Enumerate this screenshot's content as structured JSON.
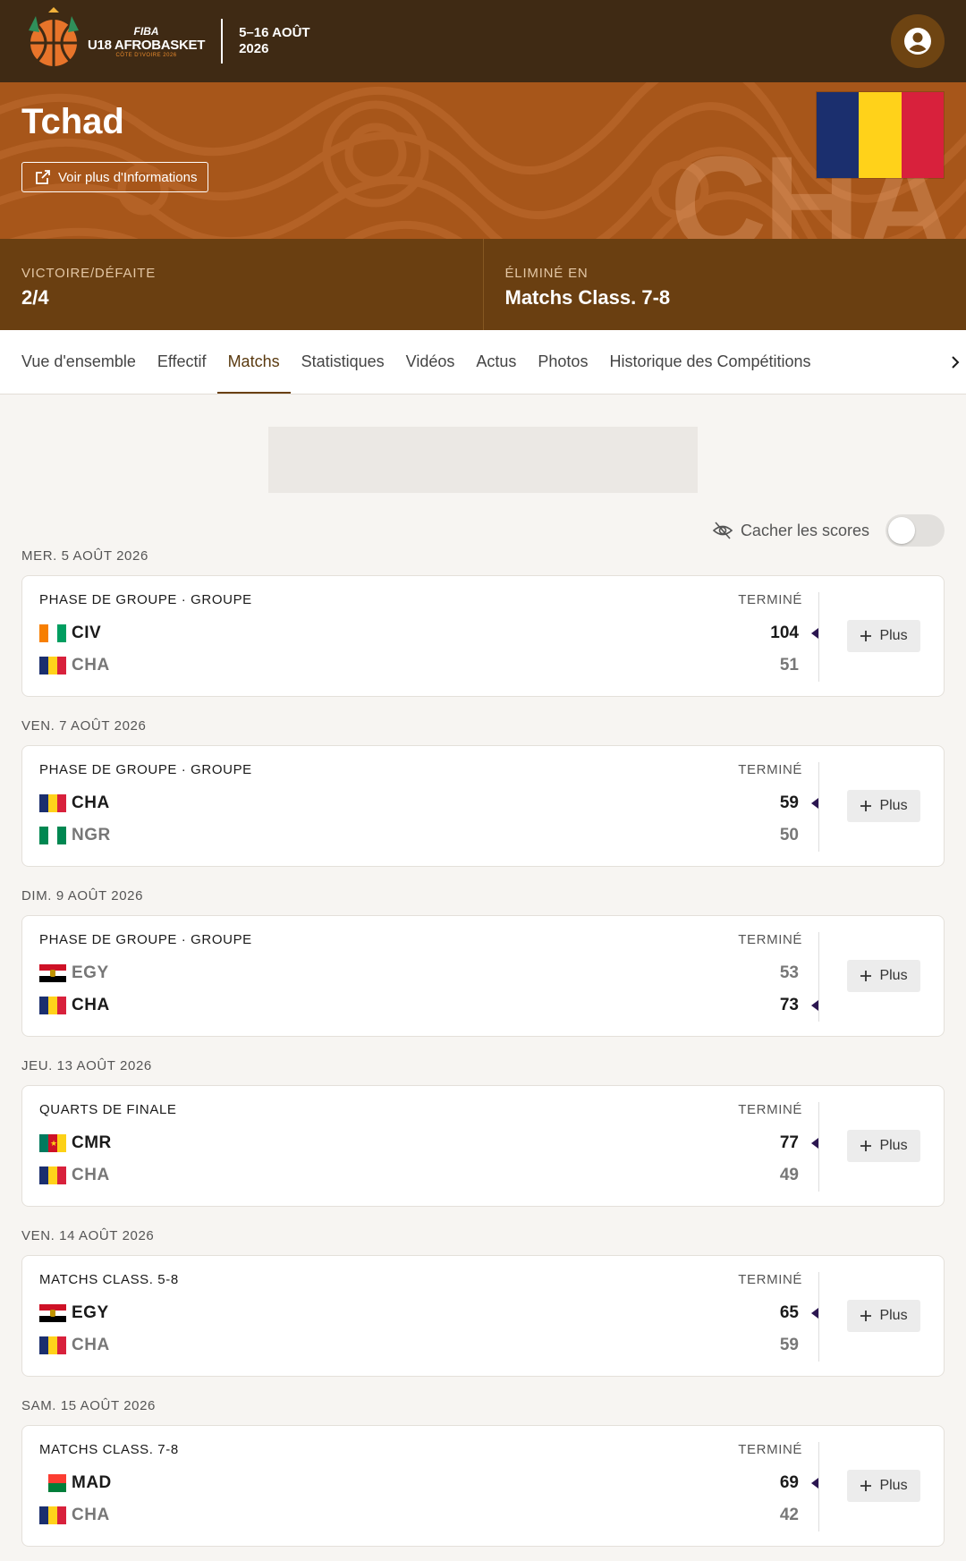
{
  "header": {
    "logo_fiba": "FIBA",
    "logo_event": "U18 AFROBASKET",
    "logo_host": "CÔTE D'IVOIRE 2026",
    "dates_line1": "5–16 AOÛT",
    "dates_line2": "2026",
    "account_icon": "user-circle-icon"
  },
  "hero": {
    "team_name": "Tchad",
    "more_info_label": "Voir plus d'Informations",
    "team_code": "CHA",
    "flag_colors": [
      "#1b2f6e",
      "#ffd21a",
      "#d8213c"
    ]
  },
  "record": {
    "wl_label": "VICTOIRE/DÉFAITE",
    "wl_value": "2/4",
    "elim_label": "ÉLIMINÉ EN",
    "elim_value": "Matchs Class. 7-8"
  },
  "tabs": [
    {
      "label": "Vue d'ensemble",
      "active": false
    },
    {
      "label": "Effectif",
      "active": false
    },
    {
      "label": "Matchs",
      "active": true
    },
    {
      "label": "Statistiques",
      "active": false
    },
    {
      "label": "Vidéos",
      "active": false
    },
    {
      "label": "Actus",
      "active": false
    },
    {
      "label": "Photos",
      "active": false
    },
    {
      "label": "Historique des Compétitions",
      "active": false
    }
  ],
  "hide_scores": {
    "label": "Cacher les scores",
    "enabled": false
  },
  "plus_label": "Plus",
  "games": [
    {
      "date": "MER. 5 AOÛT 2026",
      "phase": "PHASE DE GROUPE · GROUPE",
      "status": "TERMINÉ",
      "teams": [
        {
          "code": "CIV",
          "score": "104",
          "winner": true,
          "flag": "civ"
        },
        {
          "code": "CHA",
          "score": "51",
          "winner": false,
          "flag": "cha"
        }
      ]
    },
    {
      "date": "VEN. 7 AOÛT 2026",
      "phase": "PHASE DE GROUPE · GROUPE",
      "status": "TERMINÉ",
      "teams": [
        {
          "code": "CHA",
          "score": "59",
          "winner": true,
          "flag": "cha"
        },
        {
          "code": "NGR",
          "score": "50",
          "winner": false,
          "flag": "ngr"
        }
      ]
    },
    {
      "date": "DIM. 9 AOÛT 2026",
      "phase": "PHASE DE GROUPE · GROUPE",
      "status": "TERMINÉ",
      "teams": [
        {
          "code": "EGY",
          "score": "53",
          "winner": false,
          "flag": "egy"
        },
        {
          "code": "CHA",
          "score": "73",
          "winner": true,
          "flag": "cha"
        }
      ]
    },
    {
      "date": "JEU. 13 AOÛT 2026",
      "phase": "QUARTS DE FINALE",
      "status": "TERMINÉ",
      "teams": [
        {
          "code": "CMR",
          "score": "77",
          "winner": true,
          "flag": "cmr"
        },
        {
          "code": "CHA",
          "score": "49",
          "winner": false,
          "flag": "cha"
        }
      ]
    },
    {
      "date": "VEN. 14 AOÛT 2026",
      "phase": "MATCHS CLASS. 5-8",
      "status": "TERMINÉ",
      "teams": [
        {
          "code": "EGY",
          "score": "65",
          "winner": true,
          "flag": "egy"
        },
        {
          "code": "CHA",
          "score": "59",
          "winner": false,
          "flag": "cha"
        }
      ]
    },
    {
      "date": "SAM. 15 AOÛT 2026",
      "phase": "MATCHS CLASS. 7-8",
      "status": "TERMINÉ",
      "teams": [
        {
          "code": "MAD",
          "score": "69",
          "winner": true,
          "flag": "mad"
        },
        {
          "code": "CHA",
          "score": "42",
          "winner": false,
          "flag": "cha"
        }
      ]
    }
  ]
}
